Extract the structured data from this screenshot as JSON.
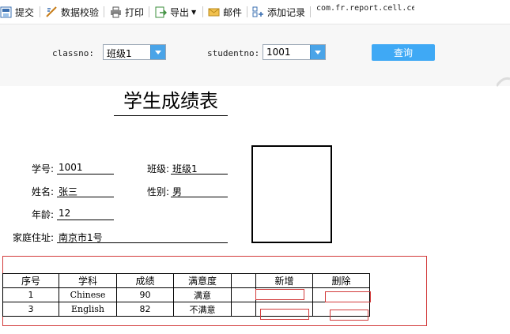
{
  "toolbar": {
    "items": [
      {
        "label": "提交",
        "icon": "submit-icon"
      },
      {
        "label": "数据校验",
        "icon": "validate-icon"
      },
      {
        "label": "打印",
        "icon": "print-icon"
      },
      {
        "label": "导出",
        "icon": "export-icon"
      },
      {
        "label": "邮件",
        "icon": "mail-icon"
      },
      {
        "label": "添加记录",
        "icon": "add-record-icon"
      }
    ],
    "class_text": "com.fr.report.cell.cellattr.core.ResultS"
  },
  "params": {
    "classno_label": "classno:",
    "classno_value": "班级1",
    "studentno_label": "studentno:",
    "studentno_value": "1001",
    "query_label": "查询"
  },
  "report": {
    "title": "学生成绩表",
    "fields": {
      "student_no_label": "学号:",
      "student_no": "1001",
      "class_label": "班级:",
      "class": "班级1",
      "name_label": "姓名:",
      "name": "张三",
      "gender_label": "性别:",
      "gender": "男",
      "age_label": "年龄:",
      "age": "12",
      "address_label": "家庭住址:",
      "address": "南京市1号"
    },
    "table": {
      "headers": [
        "序号",
        "学科",
        "成绩",
        "满意度",
        "",
        "新增",
        "删除"
      ],
      "rows": [
        [
          "1",
          "Chinese",
          "90",
          "满意"
        ],
        [
          "3",
          "English",
          "82",
          "不满意"
        ]
      ]
    }
  },
  "colors": {
    "accent": "#3fa9f5",
    "error_border": "#d23b3b"
  }
}
